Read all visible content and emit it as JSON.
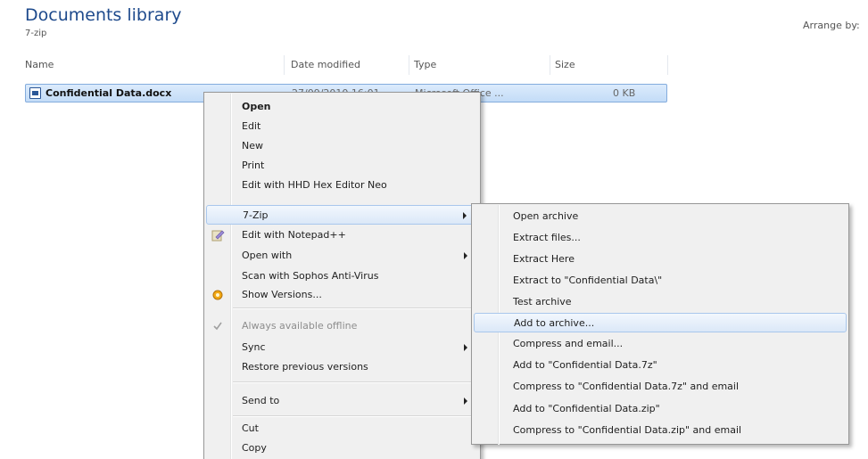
{
  "header": {
    "title": "Documents library",
    "subtitle": "7-zip",
    "arrange_label": "Arrange by:"
  },
  "columns": {
    "name": "Name",
    "date_modified": "Date modified",
    "type": "Type",
    "size": "Size"
  },
  "file": {
    "name": "Confidential Data.docx",
    "date": "27/09/2010 16:01",
    "type": "Microsoft Office ...",
    "size": "0 KB"
  },
  "context_menu": {
    "open": "Open",
    "edit": "Edit",
    "new": "New",
    "print": "Print",
    "edit_hex": "Edit with HHD Hex Editor Neo",
    "seven_zip": "7-Zip",
    "edit_notepad": "Edit with Notepad++",
    "open_with": "Open with",
    "scan_sophos": "Scan with Sophos Anti-Virus",
    "show_versions": "Show Versions...",
    "always_offline": "Always available offline",
    "sync": "Sync",
    "restore_versions": "Restore previous versions",
    "send_to": "Send to",
    "cut": "Cut",
    "copy": "Copy"
  },
  "submenu_7zip": {
    "open_archive": "Open archive",
    "extract_files": "Extract files...",
    "extract_here": "Extract Here",
    "extract_to": "Extract to \"Confidential Data\\\"",
    "test_archive": "Test archive",
    "add_to_archive": "Add to archive...",
    "compress_email": "Compress and email...",
    "add_to_7z": "Add to \"Confidential Data.7z\"",
    "compress_7z_email": "Compress to \"Confidential Data.7z\" and email",
    "add_to_zip": "Add to \"Confidential Data.zip\"",
    "compress_zip_email": "Compress to \"Confidential Data.zip\" and email"
  },
  "colors": {
    "title": "#1e4a8c",
    "selection": "#c3dcf7",
    "menu_bg": "#f0f0f0",
    "highlight_border": "#a9c7ec"
  },
  "icons": {
    "file": "word-document-icon",
    "notepad": "notepad-plus-plus-icon",
    "versions": "show-versions-icon",
    "offline": "checkmark-icon",
    "submenu": "chevron-right-icon"
  }
}
